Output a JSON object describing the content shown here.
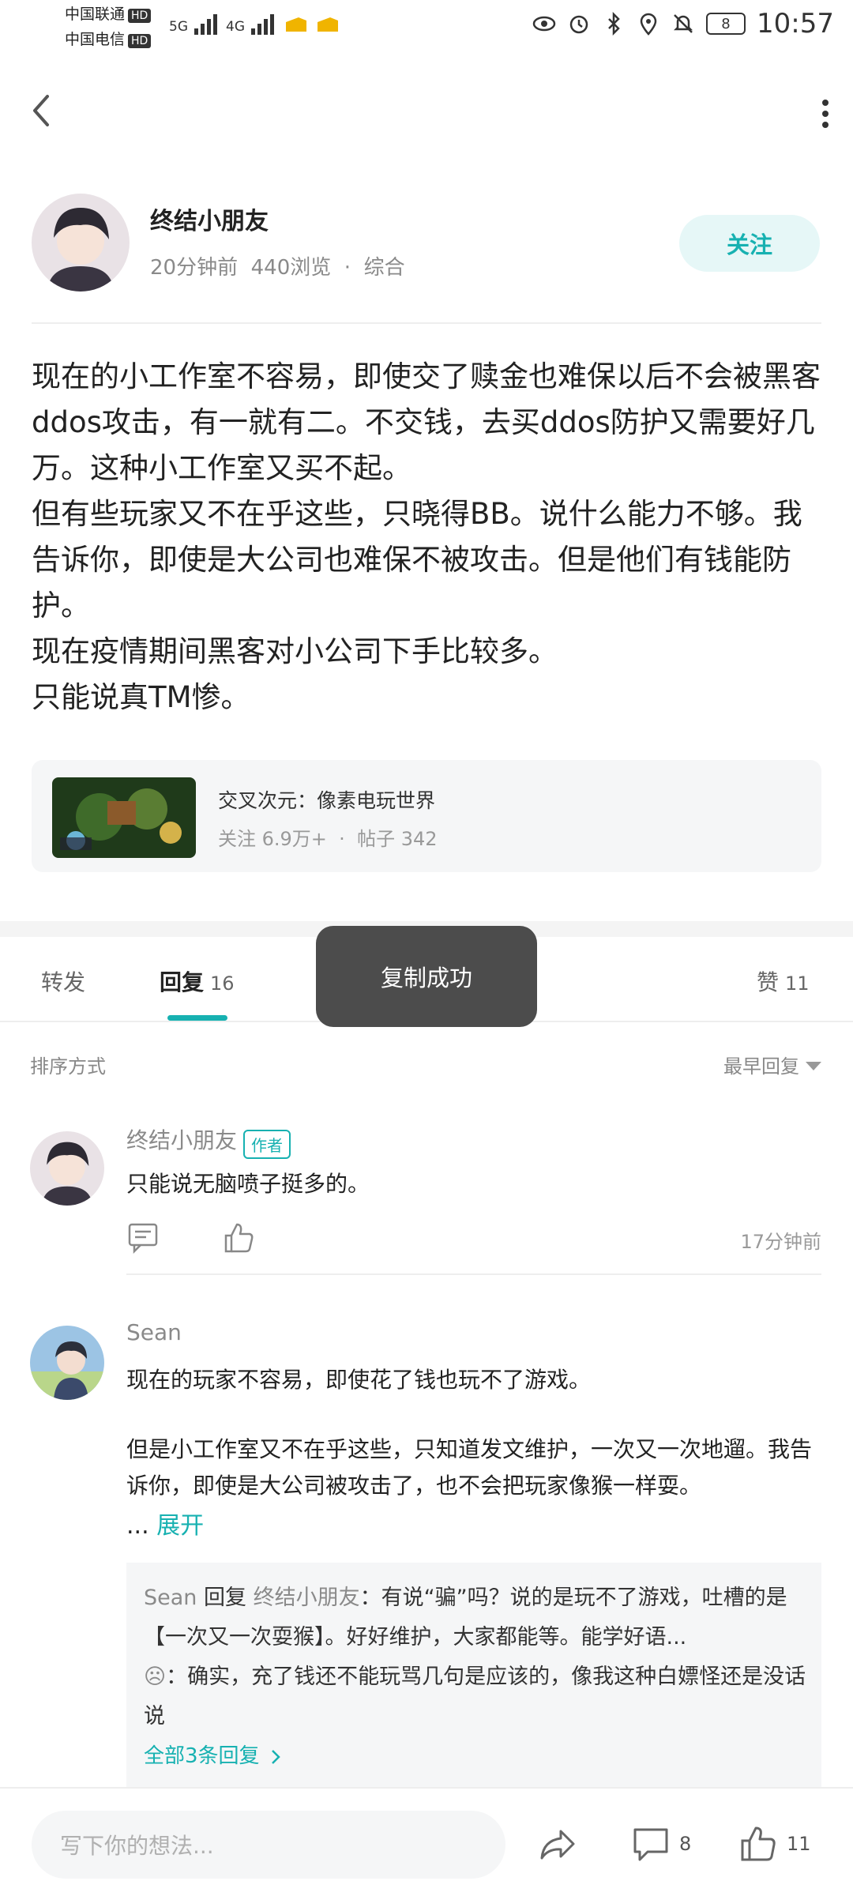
{
  "status_bar": {
    "carrier1": "中国联通",
    "carrier2": "中国电信",
    "hd": "HD",
    "net1": "5G",
    "net2": "4G",
    "battery": "8",
    "time": "10:57"
  },
  "post": {
    "author": "终结小朋友",
    "time_ago": "20分钟前",
    "views": "440浏览",
    "category": "综合",
    "meta_dot": "·",
    "follow_label": "关注",
    "paragraphs": [
      "现在的小工作室不容易，即使交了赎金也难保以后不会被黑客ddos攻击，有一就有二。不交钱，去买ddos防护又需要好几万。这种小工作室又买不起。",
      "但有些玩家又不在乎这些，只晓得BB。说什么能力不够。我告诉你，即使是大公司也难保不被攻击。但是他们有钱能防护。",
      "现在疫情期间黑客对小公司下手比较多。",
      "只能说真TM惨。"
    ]
  },
  "game_card": {
    "title": "交叉次元：像素电玩世界",
    "followers": "关注 6.9万+",
    "dot": "·",
    "posts": "帖子 342"
  },
  "tabs": {
    "repost": "转发",
    "reply": "回复",
    "reply_count": "16",
    "like": "赞",
    "like_count": "11"
  },
  "toast": "复制成功",
  "sort": {
    "label": "排序方式",
    "value": "最早回复"
  },
  "comments": [
    {
      "name": "终结小朋友",
      "badge": "作者",
      "text": "只能说无脑喷子挺多的。",
      "time": "17分钟前"
    },
    {
      "name": "Sean",
      "text1": "现在的玩家不容易，即使花了钱也玩不了游戏。",
      "text2": "但是小工作室又不在乎这些，只知道发文维护，一次又一次地遛。我告诉你，即使是大公司被攻击了，也不会把玩家像猴一样耍。",
      "ellipsis": "...",
      "expand": "展开",
      "reply": {
        "from": "Sean",
        "verb": "回复",
        "to": "终结小朋友",
        "text": "：有说“骗”吗？说的是玩不了游戏，吐槽的是【一次又一次耍猴】。好好维护，大家都能等。能学好语...",
        "second_user": "☹",
        "second_text": "：确实，充了钱还不能玩骂几句是应该的，像我这种白嫖怪还是没话说",
        "all_replies": "全部3条回复"
      }
    }
  ],
  "bottom_bar": {
    "placeholder": "写下你的想法...",
    "comment_count": "8",
    "like_count": "11"
  },
  "colors": {
    "accent": "#17b1b1",
    "follow_bg": "#e6f7f7",
    "toast_bg": "#4c4c4c"
  }
}
